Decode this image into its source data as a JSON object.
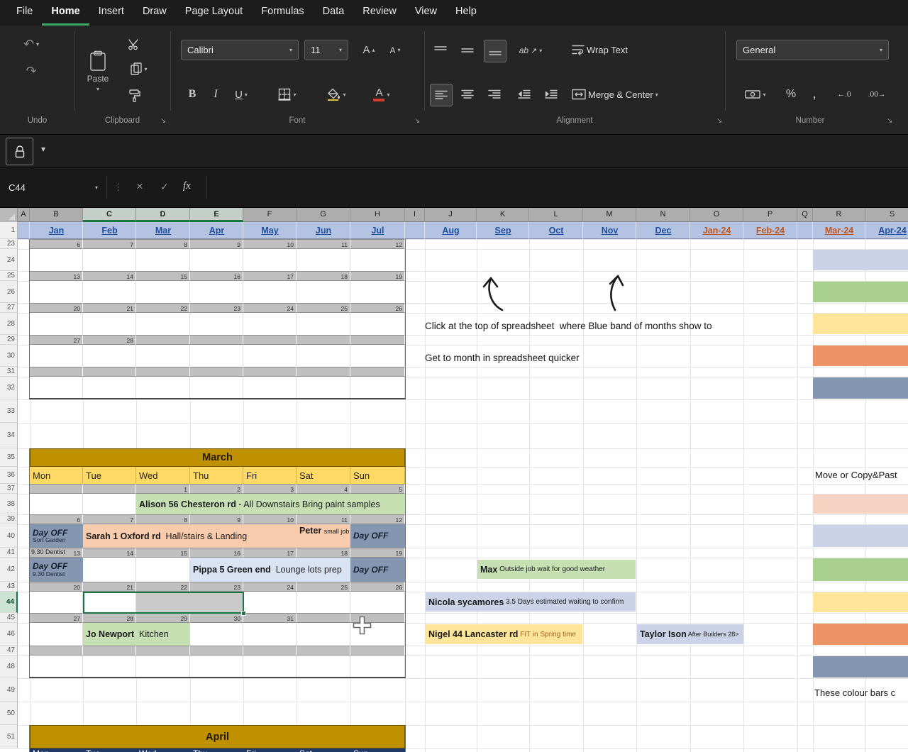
{
  "menu": {
    "items": [
      "File",
      "Home",
      "Insert",
      "Draw",
      "Page Layout",
      "Formulas",
      "Data",
      "Review",
      "View",
      "Help"
    ],
    "active": "Home"
  },
  "ribbon": {
    "group_labels": [
      "Undo",
      "Clipboard",
      "Font",
      "Alignment",
      "Number"
    ],
    "paste": "Paste",
    "font_name": "Calibri",
    "font_size": "11",
    "bold": "B",
    "italic": "I",
    "underline": "U",
    "grow_font": "A",
    "shrink_font": "A",
    "font_color_letter": "A",
    "orientation_ab": "ab",
    "diag_arrow": "↗",
    "wrap_text": "Wrap Text",
    "merge_center": "Merge & Center",
    "number_format": "General",
    "percent": "%",
    "comma": ",",
    "increase_decimal": "←.0",
    "decrease_decimal": ".00→",
    "undo": "↶",
    "redo": "↷",
    "chevron": "▾",
    "caret_up": "▴",
    "launcher": "↘"
  },
  "quick_bar": {
    "chevron": "▾"
  },
  "formula_bar": {
    "cell_ref": "C44",
    "dots": "⋮",
    "cancel": "×",
    "enter": "✓",
    "fx": "fx",
    "formula": ""
  },
  "sheet": {
    "columns": [
      "A",
      "B",
      "C",
      "D",
      "E",
      "F",
      "G",
      "H",
      "I",
      "J",
      "K",
      "L",
      "M",
      "N",
      "O",
      "P",
      "Q",
      "R",
      "S"
    ],
    "selected_columns": [
      "C",
      "D",
      "E"
    ],
    "selected_row": 44,
    "row_numbers": [
      1,
      23,
      24,
      25,
      26,
      27,
      28,
      29,
      30,
      31,
      32,
      33,
      34,
      35,
      36,
      37,
      38,
      39,
      40,
      41,
      42,
      43,
      44,
      45,
      46,
      47,
      48,
      49,
      50,
      51
    ],
    "months": [
      {
        "col": "B",
        "label": "Jan",
        "tone": "blue"
      },
      {
        "col": "C",
        "label": "Feb",
        "tone": "blue"
      },
      {
        "col": "D",
        "label": "Mar",
        "tone": "blue"
      },
      {
        "col": "E",
        "label": "Apr",
        "tone": "blue"
      },
      {
        "col": "F",
        "label": "May",
        "tone": "blue"
      },
      {
        "col": "G",
        "label": "Jun",
        "tone": "blue"
      },
      {
        "col": "H",
        "label": "Jul",
        "tone": "blue"
      },
      {
        "col": "J",
        "label": "Aug",
        "tone": "blue"
      },
      {
        "col": "K",
        "label": "Sep",
        "tone": "blue"
      },
      {
        "col": "L",
        "label": "Oct",
        "tone": "blue"
      },
      {
        "col": "M",
        "label": "Nov",
        "tone": "blue"
      },
      {
        "col": "N",
        "label": "Dec",
        "tone": "blue"
      },
      {
        "col": "O",
        "label": "Jan-24",
        "tone": "orange"
      },
      {
        "col": "P",
        "label": "Feb-24",
        "tone": "orange"
      },
      {
        "col": "R",
        "label": "Mar-24",
        "tone": "orange"
      },
      {
        "col": "S",
        "label": "Apr-24",
        "tone": "blue"
      }
    ],
    "feb_date_rows": [
      [
        "6",
        "7",
        "8",
        "9",
        "10",
        "11",
        "12"
      ],
      [
        "13",
        "14",
        "15",
        "16",
        "17",
        "18",
        "19"
      ],
      [
        "20",
        "21",
        "22",
        "23",
        "24",
        "25",
        "26"
      ],
      [
        "27",
        "28",
        "",
        "",
        "",
        "",
        ""
      ]
    ],
    "march": {
      "title": "March",
      "days": [
        "Mon",
        "Tue",
        "Wed",
        "Thu",
        "Fri",
        "Sat",
        "Sun"
      ],
      "date_rows": [
        [
          "",
          "",
          "1",
          "2",
          "3",
          "4",
          "5"
        ],
        [
          "6",
          "7",
          "8",
          "9",
          "10",
          "11",
          "12"
        ],
        [
          "13",
          "14",
          "15",
          "16",
          "17",
          "18",
          "19"
        ],
        [
          "20",
          "21",
          "22",
          "23",
          "24",
          "25",
          "26"
        ],
        [
          "27",
          "28",
          "29",
          "30",
          "31",
          "",
          ""
        ]
      ],
      "dentist_note": "9.30 Dentist",
      "events": {
        "alison": {
          "bold": "Alison 56 Chesteron rd",
          "rest": " - All Downstairs Bring paint samples"
        },
        "day_off_mon1": {
          "bold": "Day OFF",
          "sub": "Sort Garden"
        },
        "sarah": {
          "bold": "Sarah 1 Oxford rd",
          "rest": "  Hall/stairs & Landing"
        },
        "peter": {
          "bold": "Peter",
          "rest": "small job"
        },
        "day_off_sun1": {
          "bold": "Day OFF"
        },
        "day_off_mon2": {
          "bold": "Day OFF",
          "sub": "9.30 Dentist"
        },
        "pippa": {
          "bold": "Pippa 5 Green end",
          "rest": "  Lounge lots prep"
        },
        "day_off_sun2": {
          "bold": "Day OFF"
        },
        "jo": {
          "bold": "Jo Newport",
          "rest": "  Kitchen"
        }
      }
    },
    "april": {
      "title": "April",
      "days": [
        "Mon",
        "Tue",
        "Wed",
        "Thu",
        "Fri",
        "Sat",
        "Sun"
      ]
    },
    "side_events": {
      "max": {
        "bold": "Max",
        "rest": " Outside job wait for good weather"
      },
      "nicola": {
        "bold": "Nicola sycamores",
        "rest": " 3.5 Days estimated waiting to confirm"
      },
      "nigel": {
        "bold": "Nigel 44 Lancaster rd",
        "rest": " FIT in Spring time"
      },
      "taylor": {
        "bold": "Taylor Ison",
        "rest": " After Builders 28>"
      }
    },
    "annotations": {
      "note1": "Click at the top of spreadsheet  where Blue band of months show to",
      "note2": "Get to month in spreadsheet quicker",
      "right_top": "Move or Copy&Past",
      "right_bottom": "These colour bars c"
    },
    "color_bars": {
      "top": [
        "#ccd3e8",
        "#a9d08e",
        "#ffe599",
        "#ed9466",
        "#8496b0"
      ],
      "bottom": [
        "#f5d3c3",
        "#ccd3e8",
        "#a9d08e",
        "#ffe599",
        "#ed9466",
        "#8496b0"
      ]
    },
    "colors": {
      "event_green": "#c6e0b4",
      "day_off_blue": "#8496b0",
      "event_peach": "#f8cbad",
      "event_bluegray": "#dae3f3",
      "title_gold": "#bf9000",
      "day_header_gold": "#ffd966",
      "band_gray": "#bfbfbf",
      "month_band_blue": "#b5c3e3",
      "navy": "#1f3864",
      "selection_green": "#1b7741"
    }
  }
}
